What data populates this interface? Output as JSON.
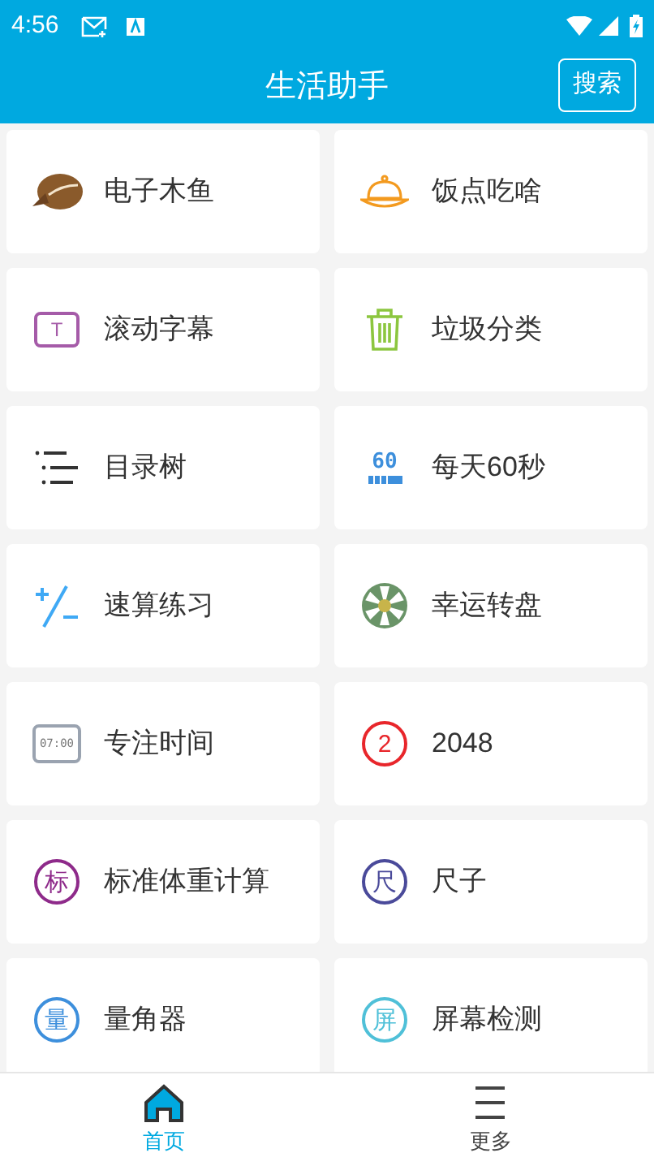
{
  "status_bar": {
    "time": "4:56"
  },
  "header": {
    "title": "生活助手",
    "search_button": "搜索"
  },
  "tools": [
    {
      "label": "电子木鱼",
      "kind": "woodfish"
    },
    {
      "label": "饭点吃啥",
      "kind": "cloche"
    },
    {
      "label": "滚动字幕",
      "kind": "marquee",
      "icon_text": "T"
    },
    {
      "label": "垃圾分类",
      "kind": "trash"
    },
    {
      "label": "目录树",
      "kind": "list"
    },
    {
      "label": "每天60秒",
      "kind": "sixty",
      "icon_text": "60"
    },
    {
      "label": "速算练习",
      "kind": "plusminus"
    },
    {
      "label": "幸运转盘",
      "kind": "wheel"
    },
    {
      "label": "专注时间",
      "kind": "clock",
      "icon_text": "07:00"
    },
    {
      "label": "2048",
      "kind": "circle",
      "icon_text": "2",
      "color": "#e8262b"
    },
    {
      "label": "标准体重计算",
      "kind": "circle",
      "icon_text": "标",
      "color": "#8e2a8a"
    },
    {
      "label": "尺子",
      "kind": "circle",
      "icon_text": "尺",
      "color": "#4a4a9a"
    },
    {
      "label": "量角器",
      "kind": "circle",
      "icon_text": "量",
      "color": "#3d8fdc"
    },
    {
      "label": "屏幕检测",
      "kind": "circle",
      "icon_text": "屏",
      "color": "#4fc0d8"
    }
  ],
  "bottom_nav": [
    {
      "label": "首页",
      "selected": true
    },
    {
      "label": "更多",
      "selected": false
    }
  ]
}
